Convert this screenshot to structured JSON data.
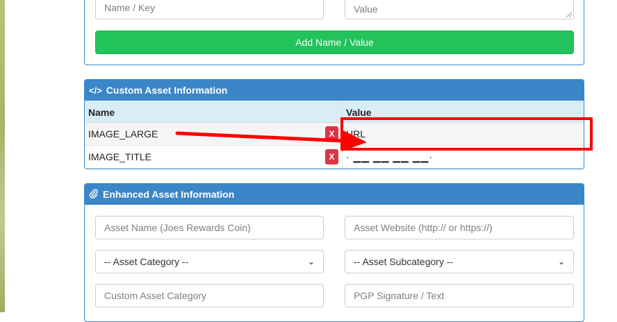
{
  "add_form": {
    "name_placeholder": "Name / Key",
    "value_placeholder": "Value",
    "add_button": "Add Name / Value"
  },
  "custom_panel": {
    "icon": "code-icon",
    "title": "Custom Asset Information",
    "col_name": "Name",
    "col_value": "Value",
    "rows": [
      {
        "name": "IMAGE_LARGE",
        "value": "URL",
        "delete": "X"
      },
      {
        "name": "IMAGE_TITLE",
        "value": "· ▁▁ ▁▁ ▁▁ ▁▁·",
        "delete": "X"
      }
    ]
  },
  "enhanced_panel": {
    "icon": "paperclip-icon",
    "title": "Enhanced Asset Information",
    "asset_name_placeholder": "Asset Name (Joes Rewards Coin)",
    "asset_website_placeholder": "Asset Website (http:// or https://)",
    "category_select": "-- Asset Category --",
    "subcategory_select": "-- Asset Subcategory --",
    "custom_category_placeholder": "Custom Asset Category",
    "pgp_placeholder": "PGP Signature / Text"
  },
  "colors": {
    "header_blue": "#3a86c9",
    "add_green": "#22c35a",
    "delete_red": "#dc3545",
    "annotation_red": "#ff0000"
  }
}
